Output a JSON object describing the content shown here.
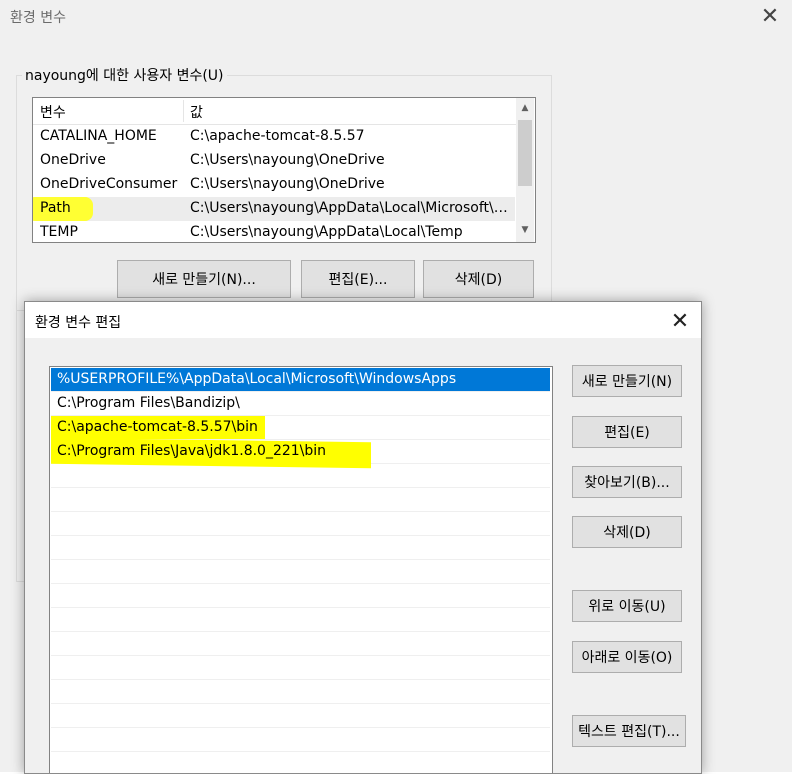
{
  "back_window": {
    "title": "환경 변수",
    "user_vars_label": "nayoung에 대한 사용자 변수(U)",
    "columns": {
      "name": "변수",
      "value": "값"
    },
    "rows": [
      {
        "name": "CATALINA_HOME",
        "value": "C:\\apache-tomcat-8.5.57"
      },
      {
        "name": "OneDrive",
        "value": "C:\\Users\\nayoung\\OneDrive"
      },
      {
        "name": "OneDriveConsumer",
        "value": "C:\\Users\\nayoung\\OneDrive"
      },
      {
        "name": "Path",
        "value": "C:\\Users\\nayoung\\AppData\\Local\\Microsoft\\WindowsApps;"
      },
      {
        "name": "TEMP",
        "value": "C:\\Users\\nayoung\\AppData\\Local\\Temp"
      }
    ],
    "buttons": {
      "new": "새로 만들기(N)...",
      "edit": "편집(E)...",
      "delete": "삭제(D)"
    }
  },
  "edit_dialog": {
    "title": "환경 변수 편집",
    "entries": [
      "%USERPROFILE%\\AppData\\Local\\Microsoft\\WindowsApps",
      "C:\\Program Files\\Bandizip\\",
      "C:\\apache-tomcat-8.5.57\\bin",
      "C:\\Program Files\\Java\\jdk1.8.0_221\\bin"
    ],
    "buttons": {
      "new": "새로 만들기(N)",
      "edit": "편집(E)",
      "browse": "찾아보기(B)...",
      "delete": "삭제(D)",
      "move_up": "위로 이동(U)",
      "move_down": "아래로 이동(O)",
      "edit_text": "텍스트 편집(T)..."
    }
  },
  "colors": {
    "selection": "#0078d7",
    "highlighter": "#ffff00",
    "dialog_bg": "#f0f0f0"
  }
}
